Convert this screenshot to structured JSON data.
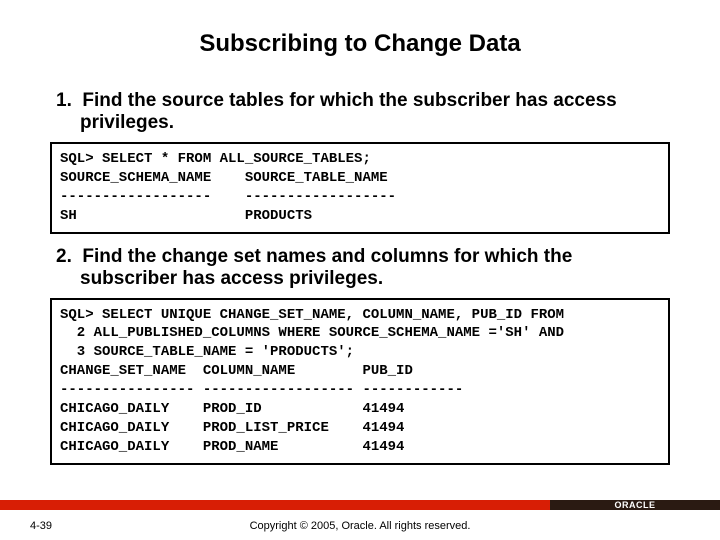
{
  "title": "Subscribing to Change Data",
  "steps": {
    "one_num": "1.",
    "one_text": "Find the source tables for which the subscriber has access privileges.",
    "two_num": "2.",
    "two_text": "Find the change set names and columns for which the subscriber has access privileges."
  },
  "code_block_1": "SQL> SELECT * FROM ALL_SOURCE_TABLES;\nSOURCE_SCHEMA_NAME    SOURCE_TABLE_NAME\n------------------    ------------------\nSH                    PRODUCTS",
  "code_block_2": "SQL> SELECT UNIQUE CHANGE_SET_NAME, COLUMN_NAME, PUB_ID FROM\n  2 ALL_PUBLISHED_COLUMNS WHERE SOURCE_SCHEMA_NAME ='SH' AND\n  3 SOURCE_TABLE_NAME = 'PRODUCTS';\nCHANGE_SET_NAME  COLUMN_NAME        PUB_ID\n---------------- ------------------ ------------\nCHICAGO_DAILY    PROD_ID            41494\nCHICAGO_DAILY    PROD_LIST_PRICE    41494\nCHICAGO_DAILY    PROD_NAME          41494",
  "footer": {
    "slide_number": "4-39",
    "copyright": "Copyright © 2005, Oracle.  All rights reserved.",
    "logo": "ORACLE"
  }
}
